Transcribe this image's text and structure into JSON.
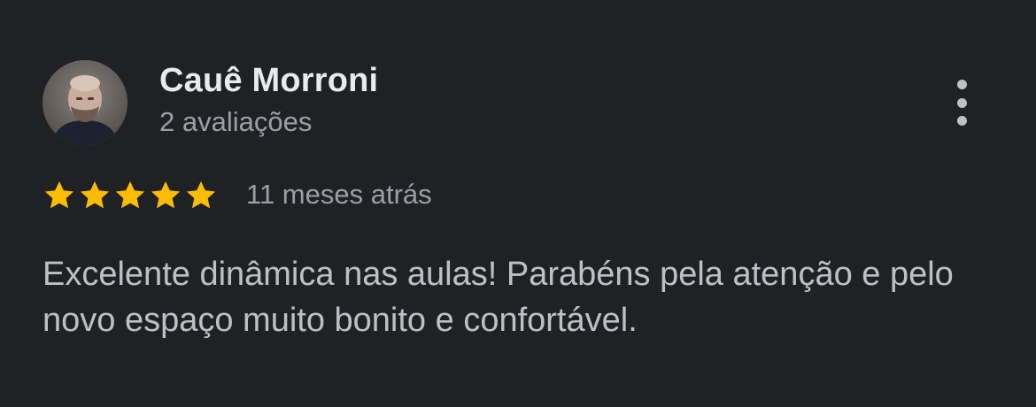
{
  "review": {
    "author_name": "Cauê Morroni",
    "author_review_count": "2 avaliações",
    "rating": 5,
    "rating_max": 5,
    "star_color": "#fbbc04",
    "time_ago": "11 meses atrás",
    "text": "Excelente dinâmica nas aulas! Parabéns pela atenção e pelo novo espaço muito bonito e confortável."
  },
  "icons": {
    "more": "more-vert-icon",
    "star": "star-icon"
  }
}
